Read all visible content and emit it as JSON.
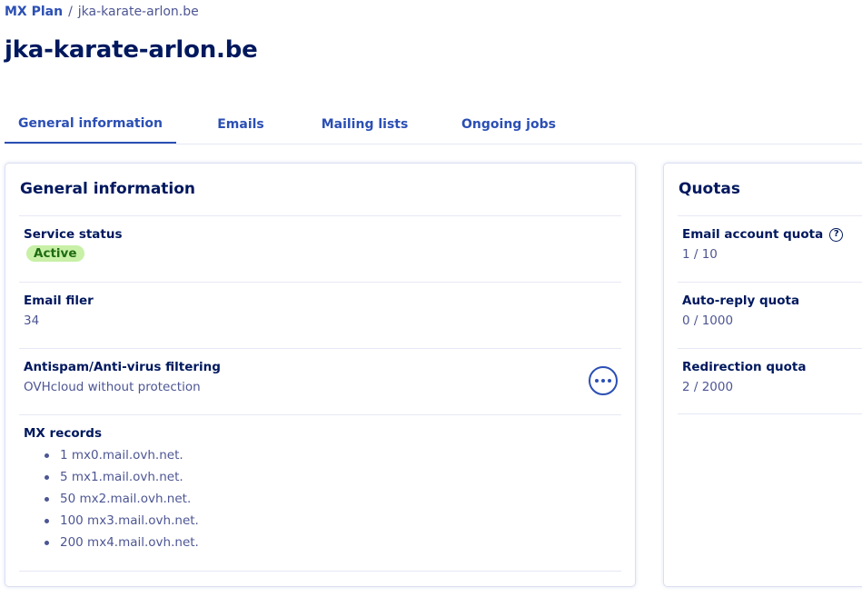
{
  "breadcrumb": {
    "root": "MX Plan",
    "separator": "/",
    "current": "jka-karate-arlon.be"
  },
  "page_title": "jka-karate-arlon.be",
  "tabs": [
    {
      "label": "General information",
      "active": true
    },
    {
      "label": "Emails",
      "active": false
    },
    {
      "label": "Mailing lists",
      "active": false
    },
    {
      "label": "Ongoing jobs",
      "active": false
    }
  ],
  "general": {
    "title": "General information",
    "service_status": {
      "label": "Service status",
      "value": "Active"
    },
    "email_filer": {
      "label": "Email filer",
      "value": "34"
    },
    "antispam": {
      "label": "Antispam/Anti-virus filtering",
      "value": "OVHcloud without protection",
      "action_icon": "more-horizontal-icon"
    },
    "mx_records": {
      "label": "MX records",
      "items": [
        "1 mx0.mail.ovh.net.",
        "5 mx1.mail.ovh.net.",
        "50 mx2.mail.ovh.net.",
        "100 mx3.mail.ovh.net.",
        "200 mx4.mail.ovh.net."
      ]
    }
  },
  "quotas": {
    "title": "Quotas",
    "email_account": {
      "label": "Email account quota",
      "value": "1 / 10",
      "help_icon": "question-circle-icon",
      "help_glyph": "?"
    },
    "auto_reply": {
      "label": "Auto-reply quota",
      "value": "0 / 1000"
    },
    "redirection": {
      "label": "Redirection quota",
      "value": "2 / 2000"
    }
  },
  "colors": {
    "primary": "#2b4fb4",
    "heading": "#00185e",
    "text_muted": "#4d5693",
    "badge_bg": "#c8f0a7",
    "badge_text": "#1f6b12"
  }
}
